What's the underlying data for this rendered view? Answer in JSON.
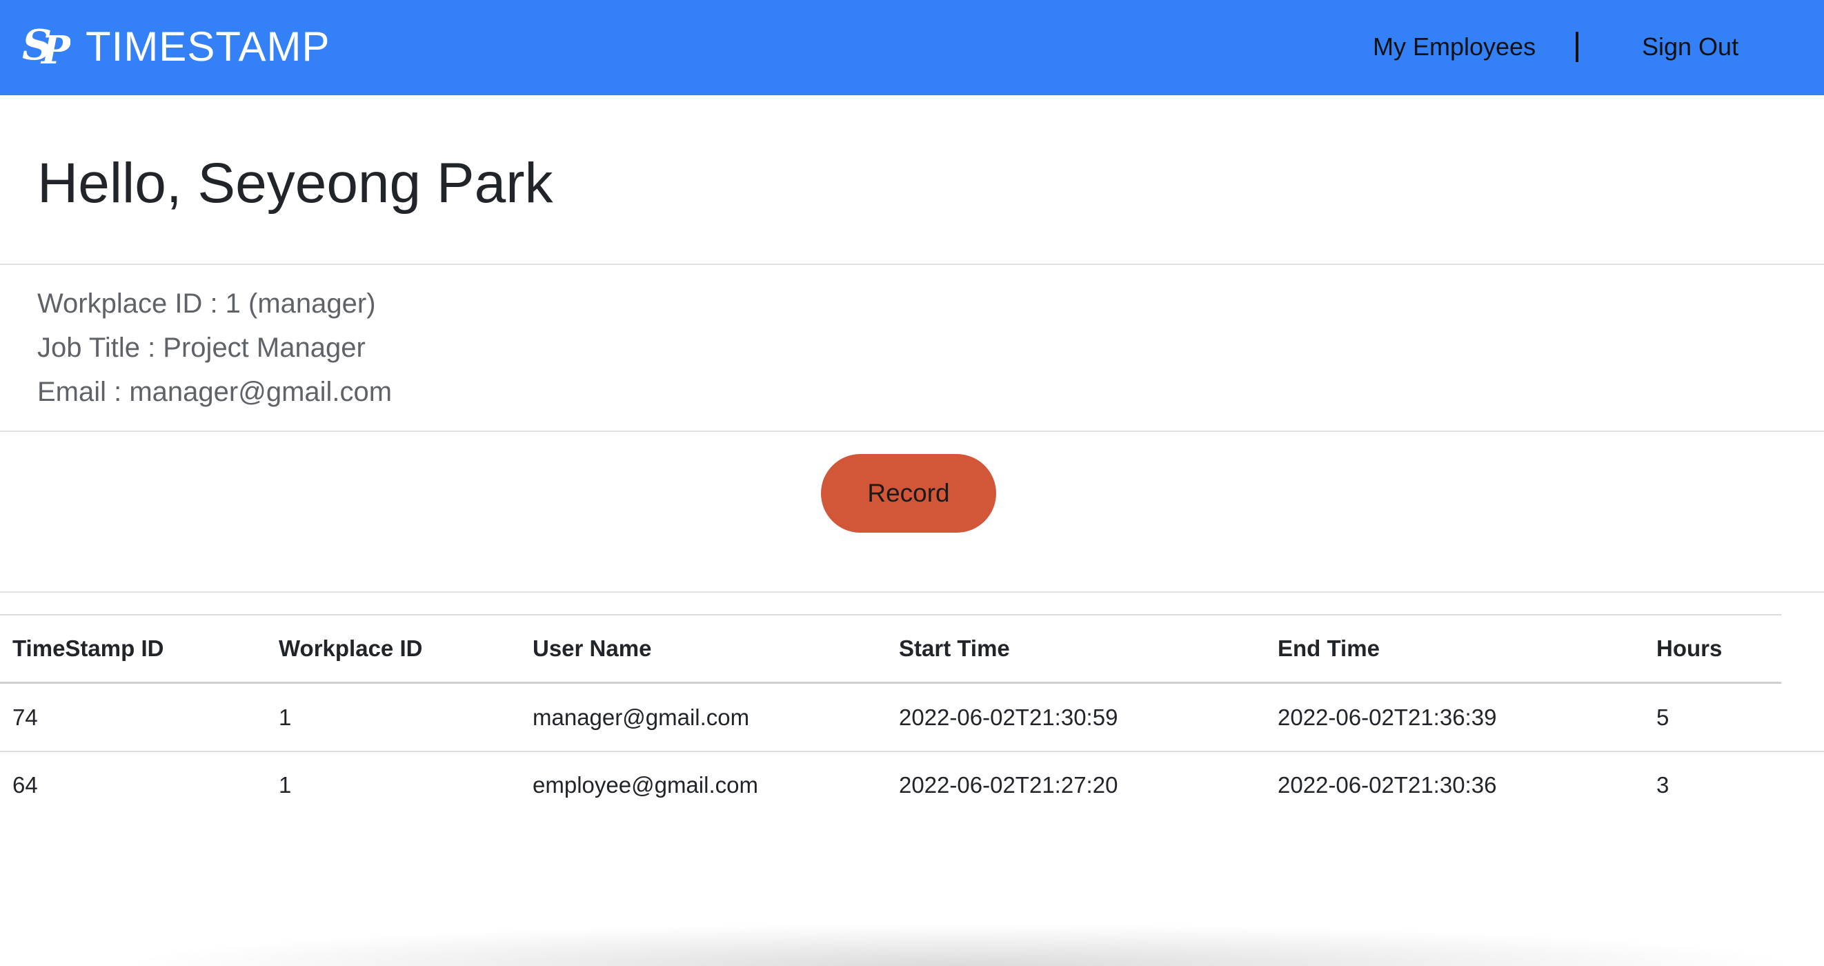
{
  "header": {
    "logo_icon": "sp-monogram-logo",
    "brand": "TIMESTAMP",
    "nav": {
      "employees_label": "My Employees",
      "signout_label": "Sign Out"
    },
    "background_color": "#3480f6"
  },
  "profile": {
    "greeting": "Hello, Seyeong Park",
    "workplace": "Workplace ID : 1 (manager)",
    "job_title": "Job Title : Project Manager",
    "email": "Email : manager@gmail.com"
  },
  "actions": {
    "record_label": "Record",
    "record_color": "#d25738"
  },
  "table": {
    "columns": [
      "TimeStamp ID",
      "Workplace ID",
      "User Name",
      "Start Time",
      "End Time",
      "Hours"
    ],
    "rows": [
      [
        "74",
        "1",
        "manager@gmail.com",
        "2022-06-02T21:30:59",
        "2022-06-02T21:36:39",
        "5"
      ],
      [
        "64",
        "1",
        "employee@gmail.com",
        "2022-06-02T21:27:20",
        "2022-06-02T21:30:36",
        "3"
      ]
    ]
  }
}
